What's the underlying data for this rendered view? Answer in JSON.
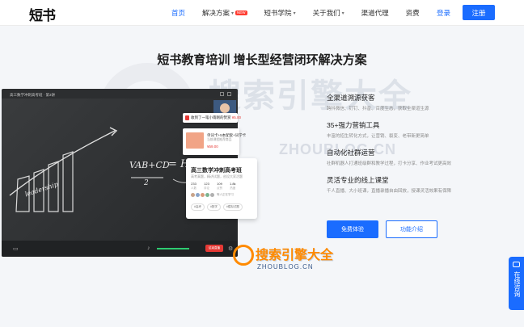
{
  "header": {
    "logo": "短书",
    "nav": [
      {
        "label": "首页",
        "active": true,
        "dropdown": false
      },
      {
        "label": "解决方案",
        "active": false,
        "dropdown": true,
        "badge": "NEW"
      },
      {
        "label": "短书学院",
        "active": false,
        "dropdown": true
      },
      {
        "label": "关于我们",
        "active": false,
        "dropdown": true
      },
      {
        "label": "渠道代理",
        "active": false,
        "dropdown": false
      },
      {
        "label": "资费",
        "active": false,
        "dropdown": false
      }
    ],
    "login_label": "登录",
    "register_label": "注册"
  },
  "hero": {
    "title": "短书教育培训 增长型经营闭环解决方案"
  },
  "watermark": {
    "title": "搜索引擎大全",
    "domain_big": "ZHOUBLOG.CN",
    "domain_small": "ZHOUBLOG.CN"
  },
  "video": {
    "top_text": "高三数学冲刺高考班 · 第3讲",
    "chalk_eq1": "VAB+CD",
    "chalk_eq2": "2",
    "chalk_eq3": "= H",
    "chalk_word": "leadership",
    "end_label": "结束直播"
  },
  "cards": {
    "notice_text": "收到了一笔小雨刚的赞赏",
    "notice_price": "¥5.00",
    "product_title": "单词卡+5本配套+词学卡",
    "product_sub": "当前课程推荐商品",
    "product_price": "¥59.00",
    "course_title": "高三数学冲刺高考班",
    "course_sub": "高考真题，精讲试题，创设大家活题",
    "stats": [
      {
        "value": "233",
        "label": "人数"
      },
      {
        "value": "123",
        "label": "评论"
      },
      {
        "value": "109",
        "label": "点赞"
      },
      {
        "value": "1.8k",
        "label": "热度"
      }
    ],
    "watchers_text": "等人正在学习",
    "tags": [
      "#高考",
      "#数学",
      "#模拟试题"
    ]
  },
  "features": [
    {
      "title": "全渠道溯源获客",
      "desc": "跨抖微信、钉钉、抖音、百度生态，获取全渠道生源"
    },
    {
      "title": "35+强力营销工具",
      "desc": "丰富的招生转化方式，让营销、裂变、老带新更简单"
    },
    {
      "title": "自动化社群运营",
      "desc": "社群机器人打通班级群和教学过程，打卡分享、作业考试更高效"
    },
    {
      "title": "灵活专业的线上课堂",
      "desc": "千人直播、大小班课，直播录播自由回放，授课灵活效果有保障"
    }
  ],
  "actions": {
    "trial_label": "免费体验",
    "intro_label": "功能介绍"
  },
  "side": {
    "consult_label": "在线咨询"
  },
  "colors": {
    "brand": "#1a6cff",
    "price": "#e53935"
  }
}
